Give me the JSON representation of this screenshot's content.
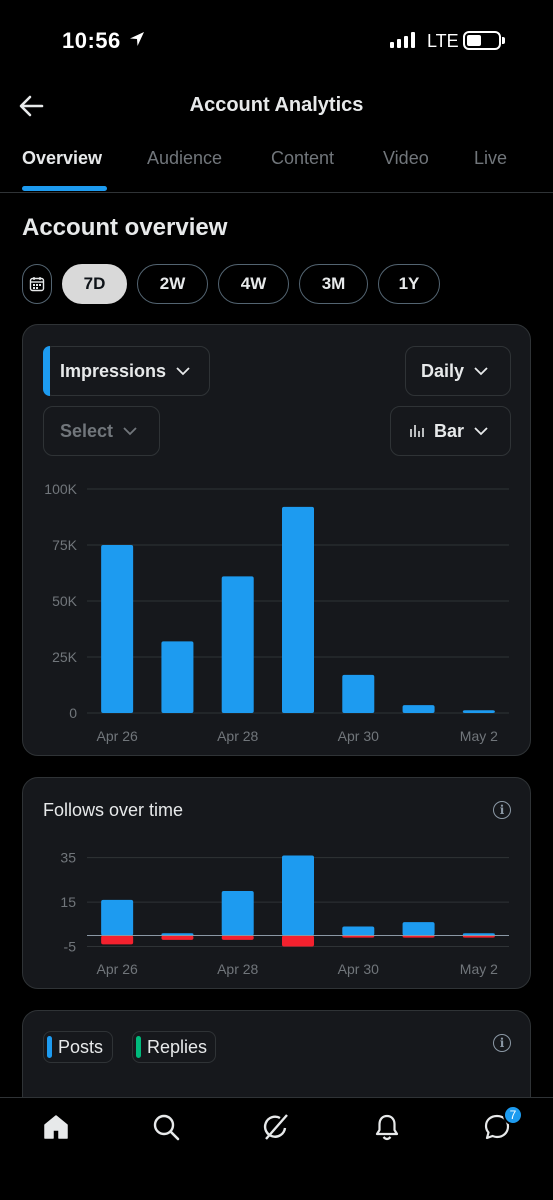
{
  "status": {
    "time": "10:56",
    "network": "LTE"
  },
  "header": {
    "title": "Account Analytics"
  },
  "tabs": [
    "Overview",
    "Audience",
    "Content",
    "Video",
    "Live"
  ],
  "overview": {
    "title": "Account overview"
  },
  "periods": [
    "7D",
    "2W",
    "4W",
    "3M",
    "1Y"
  ],
  "selected_period": "7D",
  "impressions_card": {
    "metric": "Impressions",
    "interval": "Daily",
    "compare_placeholder": "Select",
    "chart_type_label": "Bar"
  },
  "follows_card": {
    "title": "Follows over time"
  },
  "posts_card": {
    "legend": [
      "Posts",
      "Replies"
    ]
  },
  "colors": {
    "accent": "#1d9bf0",
    "negative": "#f4212e",
    "replies": "#00ba7c",
    "card_bg": "#16181c"
  },
  "nav": {
    "badge_count": "7",
    "icons": [
      "home-icon",
      "search-icon",
      "grok-icon",
      "notifications-icon",
      "messages-icon"
    ]
  },
  "chart_data": [
    {
      "type": "bar",
      "title": "Impressions",
      "categories": [
        "Apr 26",
        "Apr 27",
        "Apr 28",
        "Apr 29",
        "Apr 30",
        "May 1",
        "May 2"
      ],
      "x_tick_labels": [
        "Apr 26",
        "Apr 28",
        "Apr 30",
        "May 2"
      ],
      "values": [
        75000,
        32000,
        61000,
        92000,
        17000,
        3500,
        1200
      ],
      "y_ticks": [
        "0",
        "25K",
        "50K",
        "75K",
        "100K"
      ],
      "ylim": [
        0,
        100000
      ],
      "grid": true
    },
    {
      "type": "bar",
      "title": "Follows over time",
      "categories": [
        "Apr 26",
        "Apr 27",
        "Apr 28",
        "Apr 29",
        "Apr 30",
        "May 1",
        "May 2"
      ],
      "x_tick_labels": [
        "Apr 26",
        "Apr 28",
        "Apr 30",
        "May 2"
      ],
      "series": [
        {
          "values": [
            16,
            1,
            20,
            36,
            4,
            6,
            1
          ]
        },
        {
          "values": [
            -4,
            -2,
            -2,
            -5,
            -1,
            -1,
            -1
          ]
        }
      ],
      "y_ticks": [
        "-5",
        "15",
        "35"
      ],
      "ylim": [
        -7,
        38
      ],
      "grid": true
    }
  ]
}
